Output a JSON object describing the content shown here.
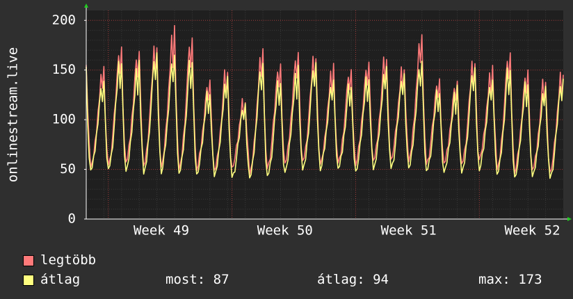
{
  "chart_data": {
    "type": "line",
    "ylabel": "onlinestream.live",
    "ylim": [
      0,
      210
    ],
    "yticks": [
      0,
      50,
      100,
      150,
      200
    ],
    "xlim": [
      0,
      27
    ],
    "xticks": [
      {
        "label": "Week 49",
        "x": 4.25
      },
      {
        "label": "Week 50",
        "x": 11.25
      },
      {
        "label": "Week 51",
        "x": 18.25
      },
      {
        "label": "Week 52",
        "x": 25.25
      }
    ],
    "grid": true,
    "x_unit": "days",
    "series": [
      {
        "name": "legtöbb",
        "color": "#ff7a7a",
        "daily_min": [
          55,
          52,
          55,
          56,
          53,
          52,
          50,
          50,
          48,
          52,
          45,
          52,
          55,
          58,
          55,
          57,
          55,
          58,
          60,
          58,
          56,
          55,
          55,
          60,
          50,
          47,
          49,
          47,
          50
        ],
        "daily_max": [
          160,
          150,
          172,
          170,
          176,
          190,
          180,
          140,
          150,
          122,
          168,
          155,
          169,
          165,
          152,
          148,
          158,
          163,
          155,
          182,
          140,
          140,
          160,
          150,
          165,
          150,
          140,
          150,
          112
        ]
      },
      {
        "name": "átlag",
        "color": "#ffff80",
        "daily_min": [
          43,
          48,
          50,
          48,
          46,
          47,
          45,
          45,
          43,
          43,
          40,
          43,
          47,
          50,
          50,
          50,
          48,
          50,
          52,
          50,
          48,
          47,
          47,
          50,
          44,
          42,
          43,
          42,
          45
        ],
        "daily_max": [
          152,
          140,
          160,
          155,
          165,
          165,
          160,
          130,
          140,
          115,
          158,
          140,
          150,
          155,
          140,
          135,
          145,
          150,
          145,
          160,
          130,
          130,
          150,
          140,
          152,
          140,
          130,
          140,
          87
        ]
      }
    ]
  },
  "legend": {
    "items": [
      {
        "label": "legtöbb",
        "color": "#ff7a7a"
      },
      {
        "label": "átlag",
        "color": "#ffff80"
      }
    ],
    "stats": {
      "most": "most: 87",
      "atlag": "átlag: 94",
      "max": "max: 173"
    }
  },
  "colors": {
    "background": "#2f2f2f",
    "plot_background": "#1f1f1f",
    "major_grid": "#a03c3c",
    "minor_grid": "#3a3a3a",
    "axis": "#ffffff",
    "arrow": "#22cc22"
  }
}
